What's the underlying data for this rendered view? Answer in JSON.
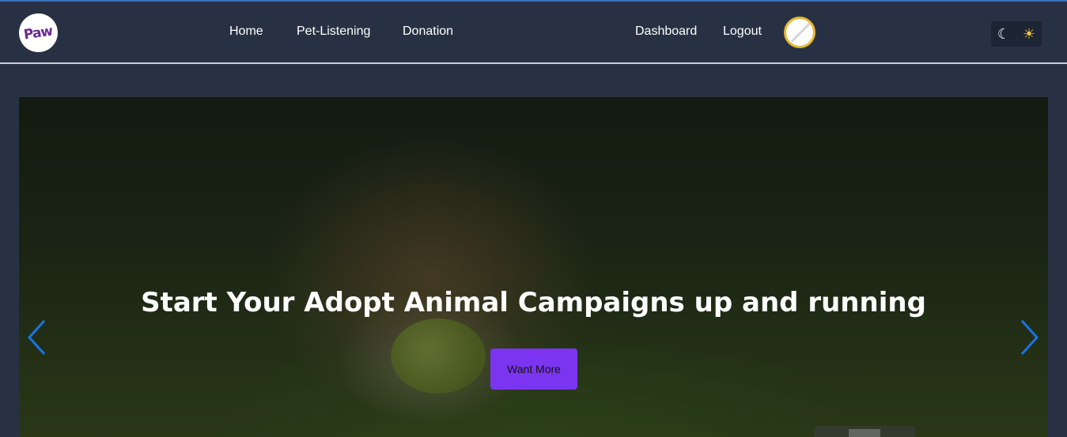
{
  "brand": {
    "logo_text": "Paw"
  },
  "nav": {
    "home": "Home",
    "pet_listening": "Pet-Listening",
    "donation": "Donation",
    "dashboard": "Dashboard",
    "logout": "Logout"
  },
  "theme_toggle": {
    "dark_icon": "☾",
    "light_icon": "☀"
  },
  "hero": {
    "title": "Start Your Adopt Animal Campaigns up and running",
    "cta_label": "Want More",
    "prev_icon": "chevron-left-icon",
    "next_icon": "chevron-right-icon"
  },
  "colors": {
    "navbar": "#283144",
    "cta": "#7b35f0",
    "arrow": "#1a73e8",
    "avatar_ring": "#e8b730"
  }
}
